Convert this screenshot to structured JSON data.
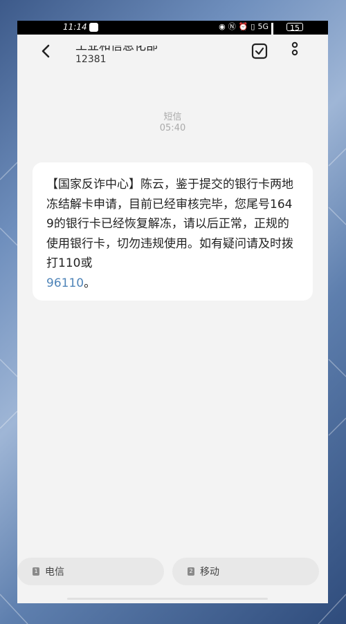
{
  "status_bar": {
    "time": "11:14",
    "network": "5G",
    "battery": "15"
  },
  "header": {
    "title": "工业和信息化部",
    "subtitle": "12381"
  },
  "conversation": {
    "type_label": "短信",
    "time": "05:40",
    "message_text": "【国家反诈中心】陈云，鉴于提交的银行卡两地冻结解卡申请，目前已经审核完毕，您尾号1649的银行卡已经恢复解冻，请以后正常，正规的使用银行卡，切勿违规使用。如有疑问请及时拨打110或",
    "message_link": "96110",
    "message_end": "。"
  },
  "bottom": {
    "sim1": {
      "number": "1",
      "label": "电信"
    },
    "sim2": {
      "number": "2",
      "label": "移动"
    }
  },
  "colors": {
    "link": "#4f84b8",
    "bubble": "#ffffff",
    "background": "#f3f3f3"
  },
  "icons": [
    "back-arrow-icon",
    "check-square-icon",
    "more-vertical-icon",
    "wechat-icon",
    "eye-icon",
    "nfc-icon",
    "alarm-icon",
    "vibrate-icon",
    "signal-icon",
    "battery-icon",
    "sim-card-icon"
  ]
}
